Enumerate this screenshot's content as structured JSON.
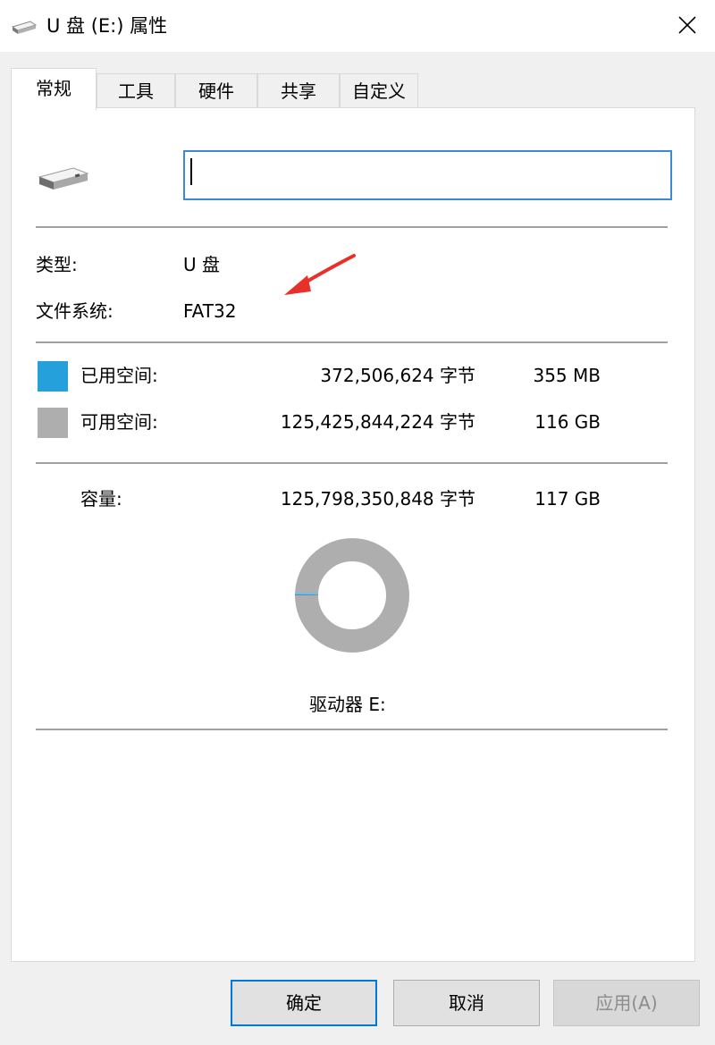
{
  "window": {
    "title": "U 盘 (E:) 属性",
    "title_icon": "usb-drive-icon",
    "close_icon": "close-icon"
  },
  "tabs": [
    {
      "label": "常规",
      "active": true
    },
    {
      "label": "工具",
      "active": false
    },
    {
      "label": "硬件",
      "active": false
    },
    {
      "label": "共享",
      "active": false
    },
    {
      "label": "自定义",
      "active": false
    }
  ],
  "general": {
    "drive_icon": "usb-drive-icon",
    "volume_name": "",
    "type_label": "类型:",
    "type_value": "U 盘",
    "fs_label": "文件系统:",
    "fs_value": "FAT32",
    "annotation_icon": "red-arrow-icon"
  },
  "usage": {
    "used": {
      "label": "已用空间:",
      "bytes": "372,506,624 字节",
      "size": "355 MB",
      "color": "#26a0da"
    },
    "free": {
      "label": "可用空间:",
      "bytes": "125,425,844,224 字节",
      "size": "116 GB",
      "color": "#aeaeae"
    },
    "capacity": {
      "label": "容量:",
      "bytes": "125,798,350,848 字节",
      "size": "117 GB"
    },
    "used_fraction": 0.003,
    "drive_label": "驱动器 E:"
  },
  "buttons": {
    "ok": "确定",
    "cancel": "取消",
    "apply": "应用(A)"
  }
}
